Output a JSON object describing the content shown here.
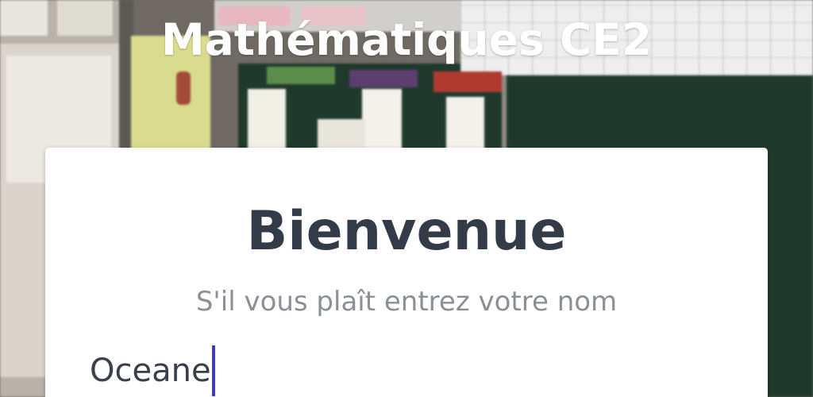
{
  "app": {
    "title": "Mathématiques CE2"
  },
  "login": {
    "heading": "Bienvenue",
    "prompt": "S'il vous plaît entrez votre nom",
    "name_value": "Oceane"
  },
  "colors": {
    "title_text": "#ffffff",
    "heading_text": "#333b48",
    "prompt_text": "#8a8f98",
    "caret": "#3b3dc8",
    "card_bg": "#ffffff"
  }
}
